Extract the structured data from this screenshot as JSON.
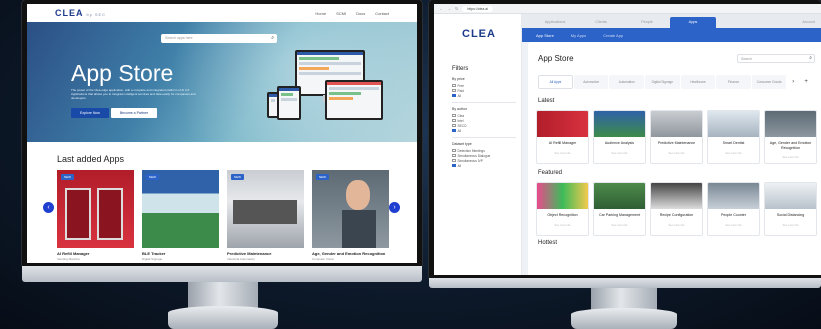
{
  "website": {
    "logo": "CLEA",
    "logo_tag": "by SEC",
    "nav_links": [
      "Home",
      "SCMI",
      "Docs",
      "Contact"
    ],
    "search_placeholder": "Search apps here",
    "hero_title": "App Store",
    "hero_description": "The power of the Clea edge application, with a complete and integrated platform of AI IoT Applications that allows you to integrate intelligent services and data easily for companies and developers.",
    "primary_button": "Explore Now",
    "secondary_button": "Become a Partner",
    "section_title": "Last added Apps",
    "cards": [
      {
        "tag": "NEW",
        "name": "AI Refill Manager",
        "sub": "Vending Machine"
      },
      {
        "tag": "NEW",
        "name": "BLE Tracker",
        "sub": "Digital Signage"
      },
      {
        "tag": "NEW",
        "name": "Predictive Maintenance",
        "sub": "Industrial Automation"
      },
      {
        "tag": "NEW",
        "name": "Age, Gender and Emotion Recognition",
        "sub": "Computer Vision"
      }
    ]
  },
  "app": {
    "url": "https://clea.ai",
    "logo": "CLEA",
    "top_tabs": [
      "Applications",
      "Clients",
      "People",
      "Apps"
    ],
    "account": "Account",
    "sub_tabs": [
      "App Store",
      "My Apps",
      "Create App"
    ],
    "page_title": "App Store",
    "search_placeholder": "Search",
    "categories": [
      "All Apps",
      "Automotive",
      "Automation",
      "Digital Signage",
      "Healthcare",
      "Finance",
      "Consumer Goods"
    ],
    "filters": {
      "title": "Filters",
      "groups": [
        {
          "label": "By price",
          "options": [
            {
              "label": "Free",
              "on": false
            },
            {
              "label": "Paid",
              "on": false
            },
            {
              "label": "All",
              "on": true
            }
          ]
        },
        {
          "label": "By author",
          "options": [
            {
              "label": "Clea",
              "on": false
            },
            {
              "label": "Intel",
              "on": false
            },
            {
              "label": "SECO",
              "on": false
            },
            {
              "label": "All",
              "on": true
            }
          ]
        },
        {
          "label": "Dataset type",
          "options": [
            {
              "label": "Detection Meetings",
              "on": false
            },
            {
              "label": "Simultaneous Dialogue",
              "on": false
            },
            {
              "label": "Simultaneous IVP",
              "on": false
            },
            {
              "label": "All",
              "on": true
            }
          ]
        }
      ]
    },
    "latest_title": "Latest",
    "latest": [
      "AI Refill Manager",
      "Audience Analysis",
      "Predictive Maintenance",
      "Smart Dentist",
      "Age, Gender and Emotion Recognition"
    ],
    "featured_title": "Featured",
    "featured": [
      "Object Recognition",
      "Car Parking Management",
      "Recipe Configuration",
      "People Counter",
      "Social Distancing"
    ],
    "hottest_title": "Hottest",
    "card_footer": "See more info"
  }
}
